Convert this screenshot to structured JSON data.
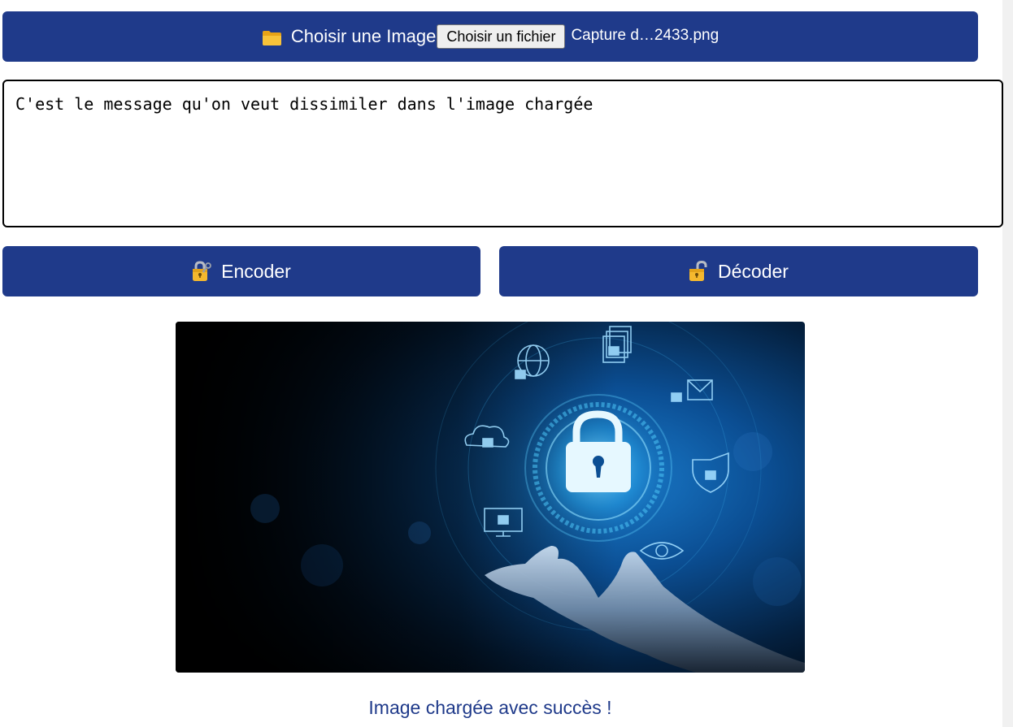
{
  "file_picker": {
    "label": "Choisir une Image",
    "button_label": "Choisir un fichier",
    "selected_file": "Capture d…2433.png",
    "icon": "folder-icon"
  },
  "message": {
    "value": "C'est le message qu'on veut dissimiler dans l'image chargée"
  },
  "actions": {
    "encode_label": "Encoder",
    "encode_icon": "lock-with-key-icon",
    "decode_label": "Décoder",
    "decode_icon": "open-lock-icon"
  },
  "preview": {
    "description_icons": [
      "globe-lock-icon",
      "documents-lock-icon",
      "mail-lock-icon",
      "cloud-lock-icon",
      "shield-lock-icon",
      "monitor-lock-icon",
      "eye-icon",
      "padlock-icon"
    ]
  },
  "status": {
    "text": "Image chargée avec succès !"
  },
  "colors": {
    "primary": "#1f3a8a",
    "status_text": "#1f3a8a",
    "icon_gold": "#f5b82e"
  }
}
